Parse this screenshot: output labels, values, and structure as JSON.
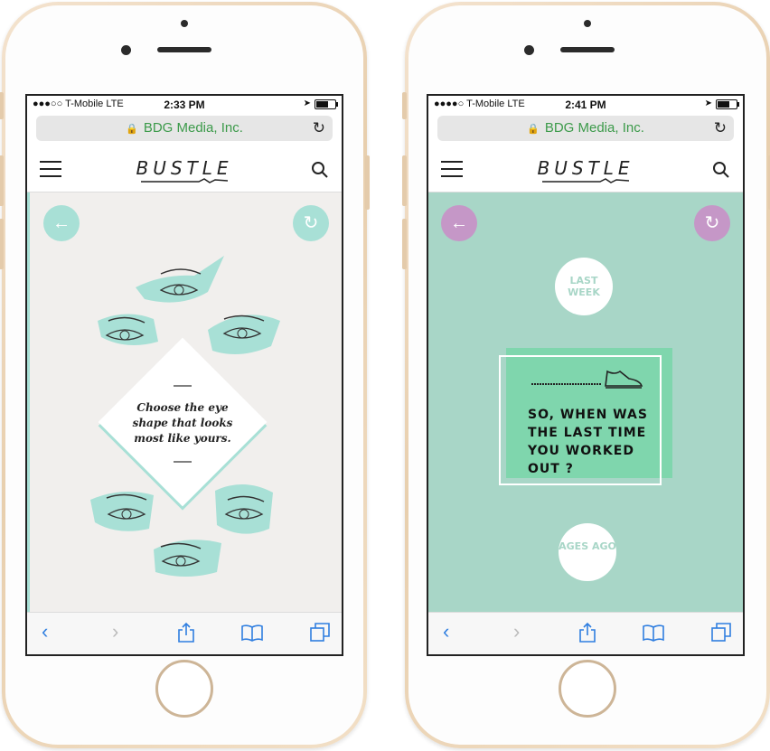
{
  "colors": {
    "mint": "#a8e0d6",
    "teal_bg": "#a8d6c7",
    "purple": "#c597c7",
    "green_card": "#7fd6ad",
    "link_blue": "#2f7ee0",
    "url_green": "#3c9a4a"
  },
  "left": {
    "status": {
      "carrier": "●●●○○ T-Mobile  LTE",
      "time": "2:33 PM"
    },
    "url": "BDG Media, Inc.",
    "logo": "BUSTLE",
    "card_text": "Choose the eye shape that looks most like yours.",
    "icons": {
      "back": "arrow-left-icon",
      "restart": "restart-icon"
    }
  },
  "right": {
    "status": {
      "carrier": "●●●●○ T-Mobile  LTE",
      "time": "2:41 PM"
    },
    "url": "BDG Media, Inc.",
    "logo": "BUSTLE",
    "answer_top": "LAST WEEK",
    "question": "SO, WHEN WAS THE LAST TIME YOU WORKED OUT ?",
    "answer_bottom": "AGES AGO"
  },
  "toolbar": {
    "back": "‹",
    "forward": "›",
    "share": "share-icon",
    "bookmarks": "book-icon",
    "tabs": "tabs-icon"
  }
}
